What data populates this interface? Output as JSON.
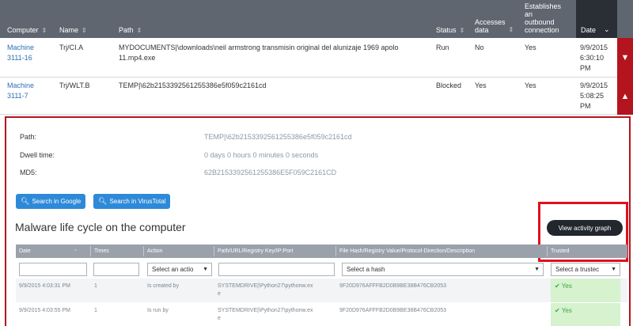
{
  "top_table": {
    "headers": {
      "computer": "Computer",
      "name": "Name",
      "path": "Path",
      "status": "Status",
      "accesses_data_l1": "Accesses",
      "accesses_data_l2": "data",
      "outbound_l1": "Establishes",
      "outbound_l2": "an",
      "outbound_l3": "outbound",
      "outbound_l4": "connection",
      "date": "Date"
    },
    "rows": [
      {
        "computer_l1": "Machine",
        "computer_l2": "3111-16",
        "name": "Trj/CI.A",
        "path_l1": "MYDOCUMENTS|\\downloads\\neil armstrong transmisin original del alunizaje 1969 apolo",
        "path_l2": "11.mp4.exe",
        "status": "Run",
        "accesses_data": "No",
        "outbound": "Yes",
        "date_l1": "9/9/2015",
        "date_l2": "6:30:10",
        "date_l3": "PM",
        "toggle": "▼"
      },
      {
        "computer_l1": "Machine",
        "computer_l2": "3111-7",
        "name": "Trj/WLT.B",
        "path_l1": "TEMP|\\62b2153392561255386e5f059c2161cd",
        "path_l2": "",
        "status": "Blocked",
        "accesses_data": "Yes",
        "outbound": "Yes",
        "date_l1": "9/9/2015",
        "date_l2": "5:08:25",
        "date_l3": "PM",
        "toggle": "▲"
      }
    ]
  },
  "detail": {
    "path_label": "Path:",
    "path_value": "TEMP|\\62b2153392561255386e5f059c2161cd",
    "dwell_label": "Dwell time:",
    "dwell_value": "0 days 0 hours 0 minutes 0 seconds",
    "md5_label": "MD5:",
    "md5_value": "62B2153392561255386E5F059C2161CD",
    "search_google": "Search in Google",
    "search_virustotal": "Search in VirusTotal",
    "section_title": "Malware life cycle on the computer",
    "view_graph": "View activity graph"
  },
  "lifecycle_table": {
    "headers": {
      "date": "Date",
      "times": "Times",
      "action": "Action",
      "path": "Path/URL/Registry Key/IP:Port",
      "hash": "File Hash/Registry Value/Protocol-Direction/Description",
      "trusted": "Trusted"
    },
    "filters": {
      "action": "Select an actio",
      "hash": "Select a hash",
      "trusted": "Select a trustec"
    },
    "rows": [
      {
        "date": "9/9/2015 4:03:31 PM",
        "times": "1",
        "action": "Is created by",
        "path_l1": "SYSTEMDRIVE|\\Python27\\pythonw.ex",
        "path_l2": "e",
        "hash": "9F20D976AFFFB2D0B9BE38B476CB2053",
        "trusted": "✔ Yes"
      },
      {
        "date": "9/9/2015 4:03:55 PM",
        "times": "1",
        "action": "Is run by",
        "path_l1": "SYSTEMDRIVE|\\Python27\\pythonw.ex",
        "path_l2": "e",
        "hash": "9F20D976AFFFB2D0B9BE38B476CB2053",
        "trusted": "✔ Yes"
      }
    ]
  },
  "colors": {
    "header_bg": "#5f6670",
    "accent_red": "#b3141e",
    "highlight_red": "#e01020",
    "link_blue": "#2e6fb5",
    "button_blue": "#2e8ad8",
    "trusted_green": "#d6f2cf"
  }
}
